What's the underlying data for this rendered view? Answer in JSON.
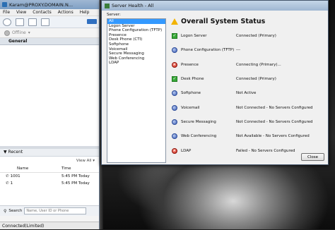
{
  "client": {
    "title": "Karam@PROXY.DOMAIN.N...",
    "menu": [
      "File",
      "View",
      "Contacts",
      "Actions",
      "Help"
    ],
    "presence": "Offline",
    "group_header": "General",
    "recent": {
      "header": "Recent",
      "view_all": "View All",
      "col_name": "Name",
      "col_time": "Time",
      "rows": [
        {
          "name": "1001",
          "time": "5:45 PM Today"
        },
        {
          "name": "1",
          "time": "5:45 PM Today"
        }
      ]
    },
    "search_label": "Search",
    "search_placeholder": "Name, User ID or Phone",
    "status": "Connected(Limited)"
  },
  "dialog": {
    "title": "Server Health - All",
    "server_label": "Server:",
    "servers": [
      "All",
      "Logon Server",
      "Phone Configuration (TFTP)",
      "Presence",
      "Desk Phone (CTI)",
      "Softphone",
      "Voicemail",
      "Secure Messaging",
      "Web Conferencing",
      "LDAP"
    ],
    "selected_server": "All",
    "overall_title": "Overall System Status",
    "rows": [
      {
        "name": "Logon Server",
        "status": "Connected (Primary)",
        "icon": "check-icon"
      },
      {
        "name": "Phone Configuration (TFTP)",
        "status": "---",
        "icon": "info-icon"
      },
      {
        "name": "Presence",
        "status": "Connecting (Primary)...",
        "icon": "error-icon"
      },
      {
        "name": "Desk Phone",
        "status": "Connected (Primary)",
        "icon": "check-icon"
      },
      {
        "name": "Softphone",
        "status": "Not Active",
        "icon": "info-icon"
      },
      {
        "name": "Voicemail",
        "status": "Not Connected - No Servers Configured",
        "icon": "info-icon"
      },
      {
        "name": "Secure Messaging",
        "status": "Not Connected - No Servers Configured",
        "icon": "info-icon"
      },
      {
        "name": "Web Conferencing",
        "status": "Not Available - No Servers Configured",
        "icon": "info-icon"
      },
      {
        "name": "LDAP",
        "status": "Failed - No Servers Configured",
        "icon": "error-icon"
      }
    ],
    "close_label": "Close"
  }
}
